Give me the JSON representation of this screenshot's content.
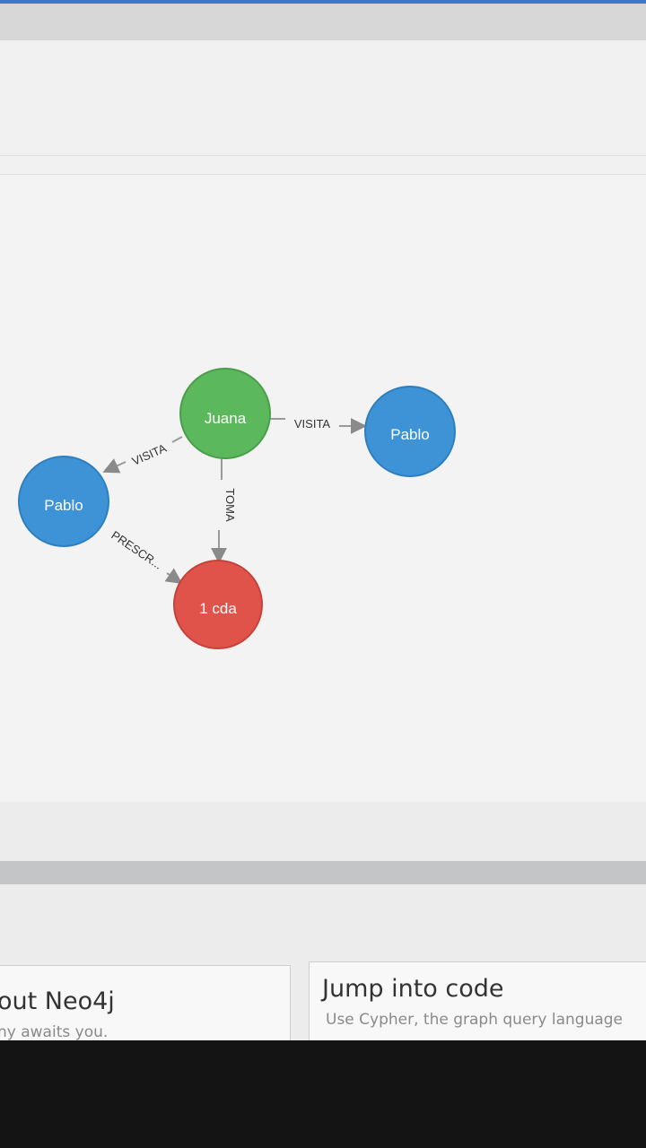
{
  "graph": {
    "nodes": [
      {
        "id": "juana",
        "label": "Juana",
        "color": "#5cb85c"
      },
      {
        "id": "pablo_right",
        "label": "Pablo",
        "color": "#3d93d6"
      },
      {
        "id": "pablo_left",
        "label": "Pablo",
        "color": "#3d93d6"
      },
      {
        "id": "cda",
        "label": "1 cda",
        "color": "#e0534a"
      }
    ],
    "relationships": [
      {
        "id": "r1",
        "type": "VISITA",
        "from": "juana",
        "to": "pablo_right"
      },
      {
        "id": "r2",
        "type": "VISITA",
        "from": "juana",
        "to": "pablo_left"
      },
      {
        "id": "r3",
        "type": "TOMA",
        "from": "juana",
        "to": "cda"
      },
      {
        "id": "r4",
        "type": "PRESCR...",
        "from": "pablo_left",
        "to": "cda"
      }
    ]
  },
  "cards": {
    "left": {
      "title": "out Neo4j",
      "subtitle": "ny awaits you."
    },
    "right": {
      "title": "Jump into code",
      "subtitle": "Use Cypher, the graph query language"
    }
  }
}
